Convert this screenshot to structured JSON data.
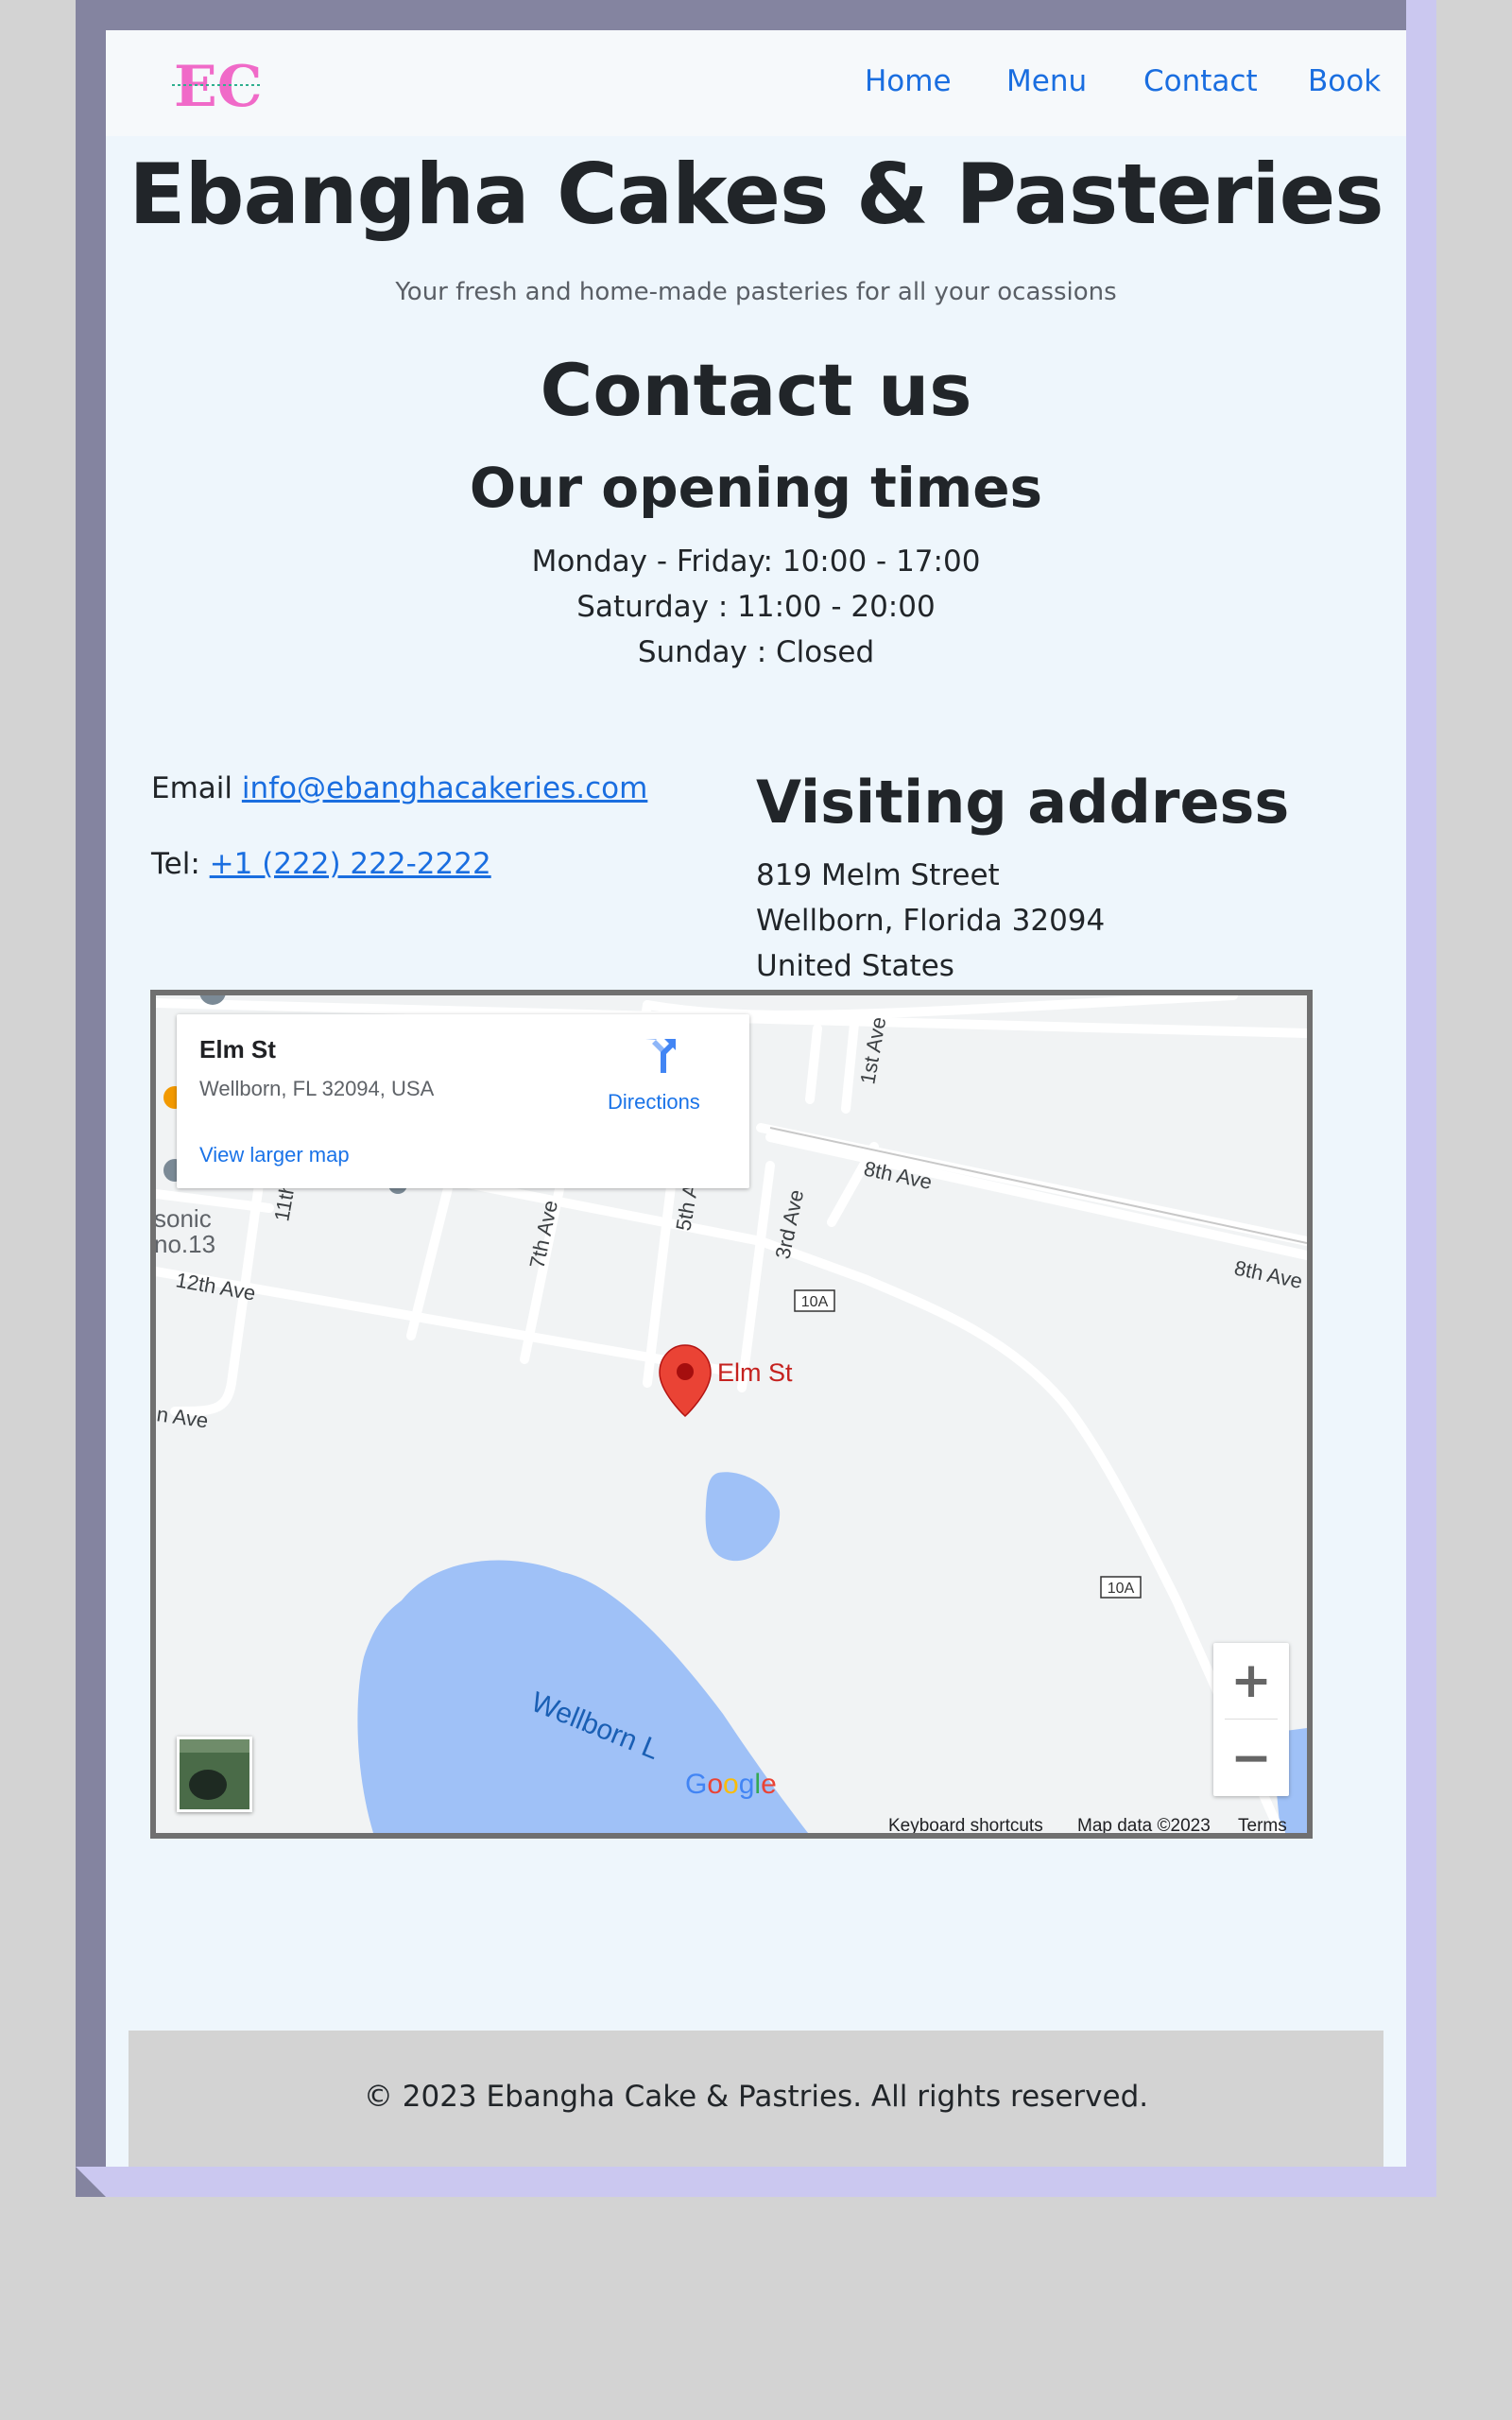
{
  "nav": {
    "logo_text": "EC",
    "links": [
      "Home",
      "Menu",
      "Contact",
      "Book"
    ]
  },
  "hero": {
    "title": "Ebangha Cakes & Pasteries",
    "subtitle": "Your fresh and home-made pasteries for all your ocassions"
  },
  "contact": {
    "title": "Contact us",
    "hours_title": "Our opening times",
    "hours": [
      "Monday - Friday: 10:00 - 17:00",
      "Saturday : 11:00 - 20:00",
      "Sunday : Closed"
    ],
    "email_label": "Email",
    "email": "info@ebanghacakeries.com",
    "tel_label": "Tel:",
    "tel": "+1 (222) 222-2222"
  },
  "address": {
    "title": "Visiting address",
    "lines": [
      "819 Melm Street",
      "Wellborn, Florida 32094",
      "United States"
    ]
  },
  "map": {
    "card_title": "Elm St",
    "card_address": "Wellborn, FL 32094, USA",
    "directions_label": "Directions",
    "larger_map_label": "View larger map",
    "marker_label": "Elm St",
    "street_labels": [
      "8th Ave",
      "8th Ave",
      "12th Ave",
      "7th Ave",
      "5th Ave",
      "3rd Ave",
      "1st Ave",
      "11th",
      "n Ave",
      "sonic",
      "no.13",
      "10A",
      "10A",
      "Wellborn L"
    ],
    "zoom_in": "+",
    "zoom_out": "−",
    "google": [
      "G",
      "o",
      "o",
      "g",
      "l",
      "e"
    ],
    "keyboard_shortcuts": "Keyboard shortcuts",
    "map_data": "Map data ©2023",
    "terms": "Terms"
  },
  "footer": {
    "text": "© 2023 Ebangha Cake & Pastries. All rights reserved."
  },
  "colors": {
    "link": "#1a6ee0",
    "page_bg": "#eef6fc",
    "frame_dark": "#8484a0",
    "frame_light": "#cbc8f0",
    "logo_pink": "#f06ac8",
    "water": "#9fc1f7",
    "marker": "#ea4335"
  }
}
